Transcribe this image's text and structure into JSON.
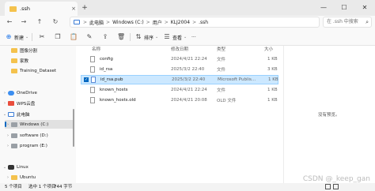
{
  "titlebar": {
    "tab_title": ".ssh",
    "tab_close": "×",
    "new_tab": "+",
    "minimize": "—",
    "maximize": "☐",
    "close": "✕"
  },
  "nav": {
    "back": "←",
    "forward": "→",
    "up": "↑",
    "refresh": "↻"
  },
  "breadcrumb": {
    "items": [
      "此电脑",
      "Windows (C:)",
      "用户",
      "KLJ2004",
      ".ssh"
    ],
    "separator": ">"
  },
  "search": {
    "placeholder": "在 .ssh 中搜索",
    "icon": "search-icon"
  },
  "toolbar": {
    "new_label": "新建",
    "sort_label": "排序",
    "view_label": "查看",
    "more_label": "···"
  },
  "sidebar": {
    "items": [
      {
        "label": "图像分割",
        "icon": "folder-icon"
      },
      {
        "label": "家教",
        "icon": "folder-icon"
      },
      {
        "label": "Training_Dataset",
        "icon": "folder-icon"
      },
      {
        "label": "OneDrive",
        "icon": "cloud-icon"
      },
      {
        "label": "WPS云盘",
        "icon": "wps-icon"
      },
      {
        "label": "此电脑",
        "icon": "pc-icon"
      },
      {
        "label": "Windows (C:)",
        "icon": "drive-icon"
      },
      {
        "label": "software (D:)",
        "icon": "drive-icon"
      },
      {
        "label": "program (E:)",
        "icon": "drive-icon"
      },
      {
        "label": "Linux",
        "icon": "linux-icon"
      },
      {
        "label": "Ubuntu",
        "icon": "folder-icon"
      }
    ]
  },
  "filelist": {
    "columns": [
      "名称",
      "修改日期",
      "类型",
      "大小"
    ],
    "rows": [
      {
        "name": "config",
        "date": "2024/4/21 22:24",
        "type": "文件",
        "size": "1 KB"
      },
      {
        "name": "id_rsa",
        "date": "2025/3/2 22:40",
        "type": "文件",
        "size": "3 KB"
      },
      {
        "name": "id_rsa.pub",
        "date": "2025/3/2 22:40",
        "type": "Microsoft Publis...",
        "size": "1 KB",
        "selected": true
      },
      {
        "name": "known_hosts",
        "date": "2024/4/21 22:24",
        "type": "文件",
        "size": "1 KB"
      },
      {
        "name": "known_hosts.old",
        "date": "2024/4/21 20:08",
        "type": "OLD 文件",
        "size": "1 KB"
      }
    ],
    "preview_message": "没有预览。"
  },
  "statusbar": {
    "count": "5 个项目",
    "selected": "选中 1 个项目",
    "size": "744 字节"
  },
  "watermark": "CSDN @_keep_gan"
}
